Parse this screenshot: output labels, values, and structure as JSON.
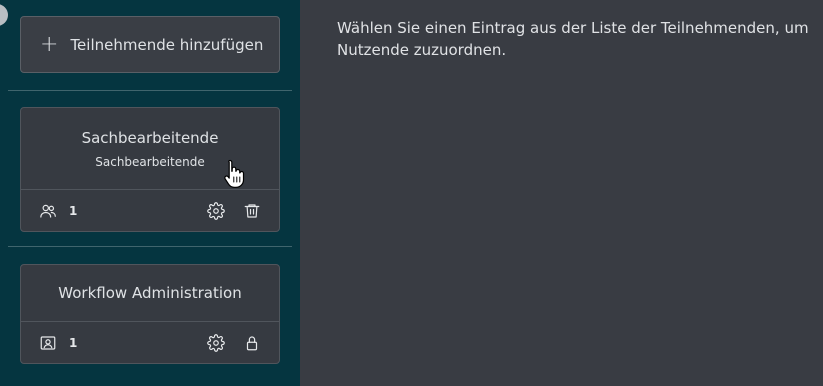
{
  "sidebar": {
    "add_button": {
      "label": "Teilnehmende hinzufügen",
      "icon": "plus-icon"
    },
    "cards": [
      {
        "title": "Sachbearbeitende",
        "subtitle": "Sachbearbeitende",
        "member_icon": "users-icon",
        "count": "1",
        "actions": [
          "gear-icon",
          "trash-icon"
        ]
      },
      {
        "title": "Workflow Administration",
        "member_icon": "user-badge-icon",
        "count": "1",
        "actions": [
          "gear-icon",
          "lock-icon"
        ]
      }
    ]
  },
  "main": {
    "message": "Wählen Sie einen Eintrag aus der Liste der Teilnehmenden, um Nutzende zuzuordnen."
  }
}
